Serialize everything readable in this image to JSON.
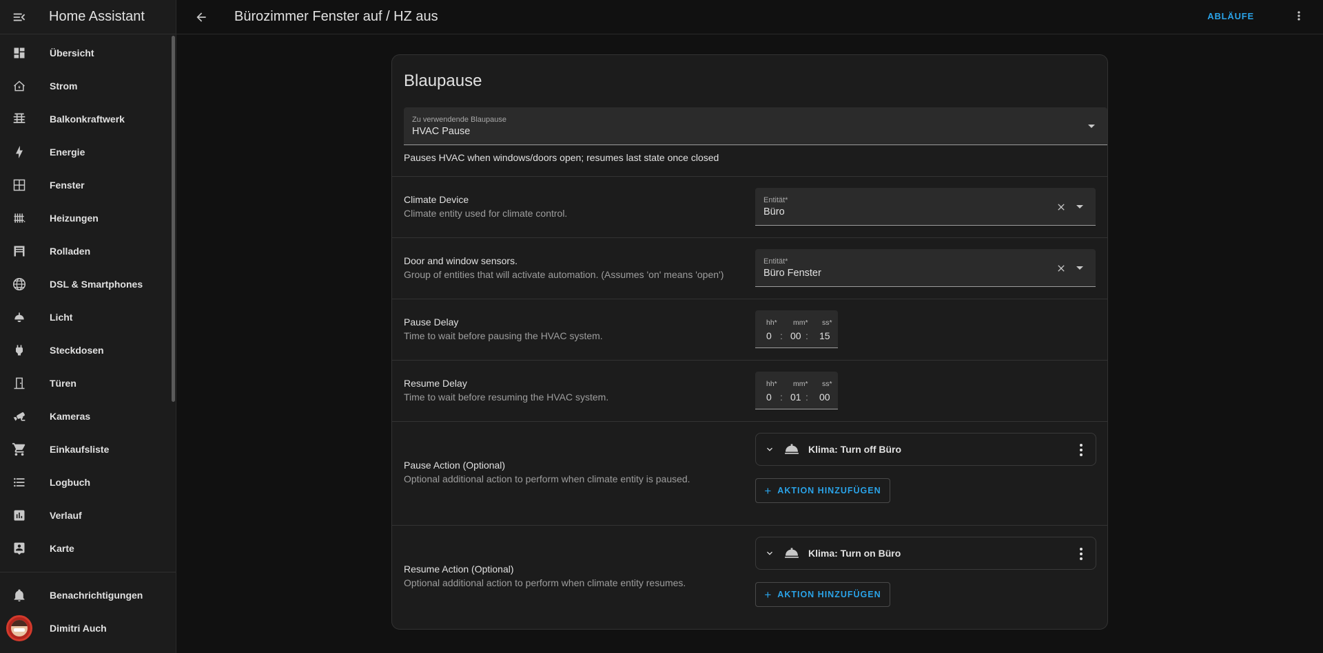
{
  "sidebar": {
    "app_title": "Home Assistant",
    "items": [
      {
        "label": "Übersicht",
        "icon": "dashboard-icon"
      },
      {
        "label": "Strom",
        "icon": "home-lightning-icon"
      },
      {
        "label": "Balkonkraftwerk",
        "icon": "solar-panel-icon"
      },
      {
        "label": "Energie",
        "icon": "lightning-bolt-icon"
      },
      {
        "label": "Fenster",
        "icon": "window-icon"
      },
      {
        "label": "Heizungen",
        "icon": "radiator-icon"
      },
      {
        "label": "Rolladen",
        "icon": "roller-shutter-icon"
      },
      {
        "label": "DSL & Smartphones",
        "icon": "globe-icon"
      },
      {
        "label": "Licht",
        "icon": "ceiling-light-icon"
      },
      {
        "label": "Steckdosen",
        "icon": "power-plug-icon"
      },
      {
        "label": "Türen",
        "icon": "door-icon"
      },
      {
        "label": "Kameras",
        "icon": "cctv-icon"
      },
      {
        "label": "Einkaufsliste",
        "icon": "cart-icon"
      },
      {
        "label": "Logbuch",
        "icon": "format-list-icon"
      },
      {
        "label": "Verlauf",
        "icon": "chart-box-icon"
      },
      {
        "label": "Karte",
        "icon": "map-account-icon"
      }
    ],
    "notifications_label": "Benachrichtigungen",
    "user_name": "Dimitri Auch"
  },
  "topbar": {
    "title": "Bürozimmer Fenster auf / HZ aus",
    "ablaeufe_label": "ABLÄUFE"
  },
  "card": {
    "title": "Blaupause",
    "blueprint_select": {
      "label": "Zu verwendende Blaupause",
      "value": "HVAC Pause"
    },
    "blueprint_description": "Pauses HVAC when windows/doors open; resumes last state once closed",
    "climate": {
      "name": "Climate Device",
      "description": "Climate entity used for climate control.",
      "field_label": "Entität*",
      "field_value": "Büro"
    },
    "sensors": {
      "name": "Door and window sensors.",
      "description": "Group of entities that will activate automation. (Assumes 'on' means 'open')",
      "field_label": "Entität*",
      "field_value": "Büro Fenster"
    },
    "pause_delay": {
      "name": "Pause Delay",
      "description": "Time to wait before pausing the HVAC system.",
      "hh_label": "hh*",
      "mm_label": "mm*",
      "ss_label": "ss*",
      "hh": "0",
      "mm": "00",
      "ss": "15"
    },
    "resume_delay": {
      "name": "Resume Delay",
      "description": "Time to wait before resuming the HVAC system.",
      "hh_label": "hh*",
      "mm_label": "mm*",
      "ss_label": "ss*",
      "hh": "0",
      "mm": "01",
      "ss": "00"
    },
    "pause_action": {
      "name": "Pause Action (Optional)",
      "description": "Optional additional action to perform when climate entity is paused.",
      "action_text": "Klima: Turn off Büro",
      "add_label": "AKTION HINZUFÜGEN"
    },
    "resume_action": {
      "name": "Resume Action (Optional)",
      "description": "Optional additional action to perform when climate entity resumes.",
      "action_text": "Klima: Turn on Büro",
      "add_label": "AKTION HINZUFÜGEN"
    }
  },
  "colors": {
    "accent": "#2aa3e8",
    "background": "#111111",
    "surface": "#1c1c1c",
    "field": "#2b2b2b"
  }
}
